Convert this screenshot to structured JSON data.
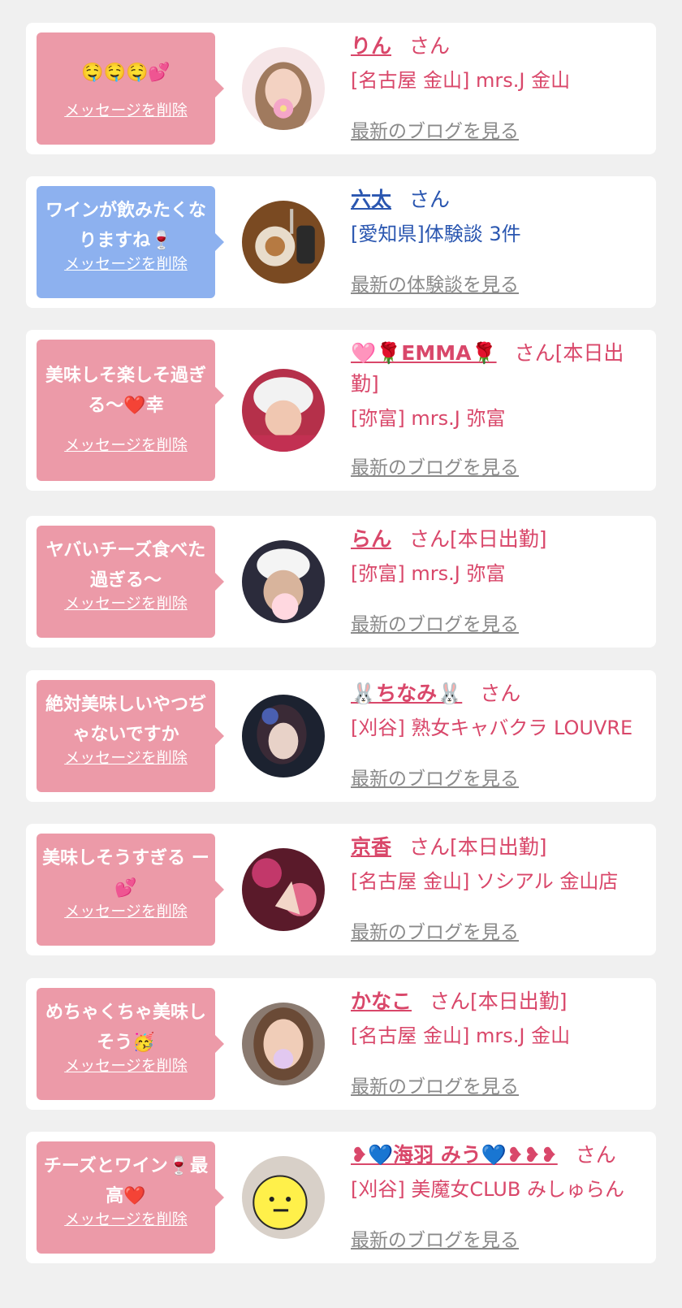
{
  "cards": [
    {
      "message": "🤤🤤🤤💕",
      "delete_label": "メッセージを削除",
      "name": "りん",
      "san": "さん",
      "shop": "[名古屋 金山] mrs.J 金山",
      "link": "最新のブログを見る"
    },
    {
      "message": "ワインが飲みたくなりますね🍷",
      "delete_label": "メッセージを削除",
      "name": "六太",
      "san": "さん",
      "shop": "[愛知県]体験談 3件",
      "link": "最新の体験談を見る"
    },
    {
      "message": "美味しそ楽しそ過ぎる〜❤️幸",
      "delete_label": "メッセージを削除",
      "name": "🩷🌹EMMA🌹",
      "san": "さん[本日出勤]",
      "shop": "[弥富] mrs.J 弥富",
      "link": "最新のブログを見る"
    },
    {
      "message": "ヤバいチーズ食べた過ぎる〜",
      "delete_label": "メッセージを削除",
      "name": "らん",
      "san": "さん[本日出勤]",
      "shop": "[弥富] mrs.J 弥富",
      "link": "最新のブログを見る"
    },
    {
      "message": "絶対美味しいやつぢゃないですか",
      "delete_label": "メッセージを削除",
      "name": "🐰ちなみ🐰",
      "san": "さん",
      "shop": "[刈谷] 熟女キャバクラ LOUVRE",
      "link": "最新のブログを見る"
    },
    {
      "message": "美味しそうすぎる ー💕",
      "delete_label": "メッセージを削除",
      "name": "京香",
      "san": "さん[本日出勤]",
      "shop": "[名古屋 金山] ソシアル 金山店",
      "link": "最新のブログを見る"
    },
    {
      "message": "めちゃくちゃ美味しそう🥳",
      "delete_label": "メッセージを削除",
      "name": "かなこ",
      "san": "さん[本日出勤]",
      "shop": "[名古屋 金山] mrs.J 金山",
      "link": "最新のブログを見る"
    },
    {
      "message": "チーズとワイン🍷最高❤️",
      "delete_label": "メッセージを削除",
      "name": "❥💙海羽 みう💙❥❥❥",
      "san": "さん",
      "shop": "[刈谷] 美魔女CLUB みしゅらん",
      "link": "最新のブログを見る"
    }
  ],
  "colors": {
    "pink_bubble": "#ec9aa8",
    "blue_bubble": "#8db1ef",
    "name_pink": "#d9476a",
    "name_blue": "#2a56b0",
    "link_gray": "#8a8a8a"
  }
}
